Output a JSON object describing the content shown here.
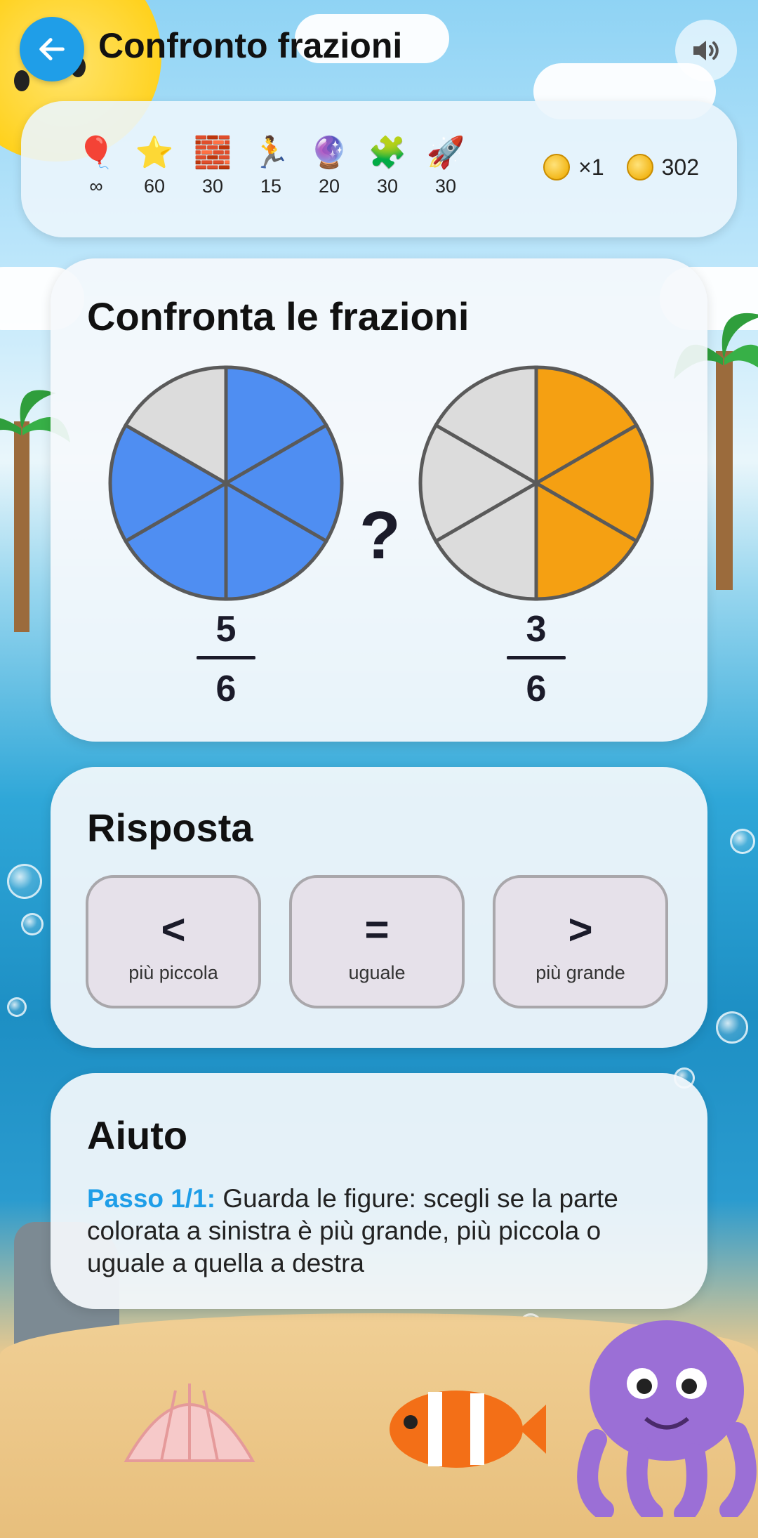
{
  "header": {
    "title": "Confronto frazioni"
  },
  "stats": {
    "items": [
      {
        "icon": "balloon-icon",
        "glyph": "🎈",
        "value": "∞"
      },
      {
        "icon": "star-icon",
        "glyph": "⭐",
        "value": "60"
      },
      {
        "icon": "brick-icon",
        "glyph": "🧱",
        "value": "30"
      },
      {
        "icon": "runner-icon",
        "glyph": "🏃",
        "value": "15"
      },
      {
        "icon": "crystal-ball-icon",
        "glyph": "🔮",
        "value": "20"
      },
      {
        "icon": "puzzle-icon",
        "glyph": "🧩",
        "value": "30"
      },
      {
        "icon": "rocket-icon",
        "glyph": "🚀",
        "value": "30"
      }
    ],
    "multiplier": "×1",
    "coins": "302"
  },
  "compare": {
    "heading": "Confronta le frazioni",
    "question_mark": "?",
    "left": {
      "numerator": "5",
      "denominator": "6",
      "filled": 5,
      "parts": 6,
      "color": "#4f8ef2"
    },
    "right": {
      "numerator": "3",
      "denominator": "6",
      "filled": 3,
      "parts": 6,
      "color": "#f5a012"
    },
    "empty_color": "#dcdcdc"
  },
  "answer": {
    "heading": "Risposta",
    "options": [
      {
        "symbol": "<",
        "label": "più piccola"
      },
      {
        "symbol": "=",
        "label": "uguale"
      },
      {
        "symbol": ">",
        "label": "più grande"
      }
    ]
  },
  "help": {
    "heading": "Aiuto",
    "step": "Passo 1/1:",
    "text": " Guarda le figure: scegli se la parte colorata a sinistra è più grande, più piccola o uguale a quella a destra"
  },
  "colors": {
    "accent": "#1f9ee8"
  }
}
